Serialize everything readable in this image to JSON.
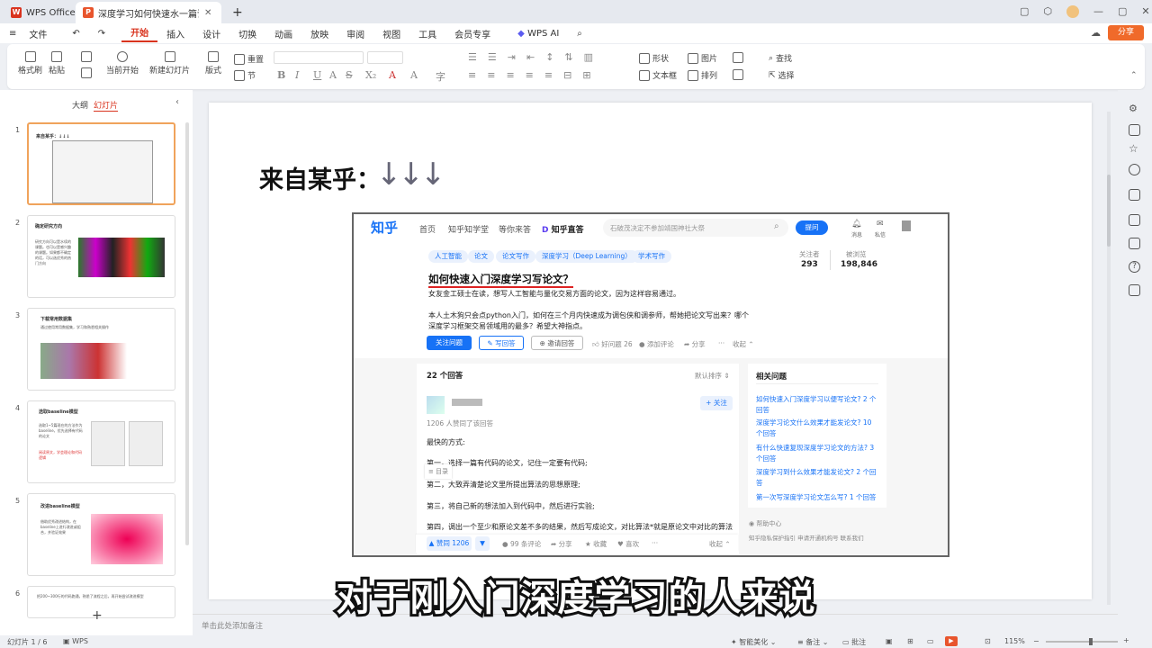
{
  "titlebar": {
    "app_tab": "WPS Office",
    "doc_tab": "深度学习如何快速水一篇论文...",
    "plus": "+"
  },
  "menubar": {
    "file": "文件",
    "items": [
      "开始",
      "插入",
      "设计",
      "切换",
      "动画",
      "放映",
      "审阅",
      "视图",
      "工具",
      "会员专享"
    ],
    "ai": "WPS AI",
    "share": "分享"
  },
  "ribbon": {
    "format_painter": "格式刷",
    "paste": "粘贴",
    "play_from": "当前开始",
    "new_slide": "新建幻灯片",
    "layout": "版式",
    "reset": "重置",
    "section": "节",
    "shape": "形状",
    "picture": "图片",
    "find": "查找",
    "textbox": "文本框",
    "arrange": "排列",
    "select": "选择"
  },
  "leftpanel": {
    "tab_outline": "大纲",
    "tab_slides": "幻灯片",
    "slides": [
      {
        "num": "1",
        "title": "来自某乎：↓↓↓"
      },
      {
        "num": "2",
        "title": "确定研究方向",
        "body": "研究方向可以是水续的课题。也可以是感兴趣的课题。如果都不确定的话，可以选优秀的热门方向"
      },
      {
        "num": "3",
        "title": "下载常用数据集",
        "body": "通过使用常用数据集，学习和熟悉相关操作"
      },
      {
        "num": "4",
        "title": "选取baseline模型",
        "body": "选取1~5篇现在的方法作为baseline，优先选择有代码的论文",
        "red": "阅读原文，学会理论和代码逻辑"
      },
      {
        "num": "5",
        "title": "改进baseline模型",
        "body": "借助优秀改进结构，在baseline上进行改进或组合，并验证效果"
      },
      {
        "num": "6",
        "body": "把200~300行的代码跑通，熟悉了流程之后，再开始尝试改进模型"
      }
    ]
  },
  "slide": {
    "title": "来自某乎：",
    "arrows": "↓↓↓",
    "subtitle": "对于刚入门深度学习的人来说"
  },
  "zhihu": {
    "logo": "知乎",
    "nav": [
      "首页",
      "知乎知学堂",
      "等你来答"
    ],
    "direct": "知乎直答",
    "search_placeholder": "石破茂决定不参加靖国神社大祭",
    "ask": "提问",
    "msg": "消息",
    "dm": "私信",
    "tags": [
      "人工智能",
      "论文",
      "论文写作",
      "深度学习（Deep Learning）",
      "学术写作"
    ],
    "followers_label": "关注者",
    "followers": "293",
    "views_label": "被浏览",
    "views": "198,846",
    "question": "如何快速入门深度学习写论文？",
    "desc1": "女友金工硕士在读，想写人工智能与量化交易方面的论文，因为这样容易通过。",
    "desc2": "本人土木狗只会点python入门，如何在三个月内快速成为调包侠和调参师，帮她把论文写出来？哪个",
    "desc3": "深度学习框架交易领域用的最多？希望大神指点。",
    "follow_q": "关注问题",
    "write": "写回答",
    "invite": "邀请回答",
    "good_q": "好问题 26",
    "comment": "添加评论",
    "share": "分享",
    "fold": "收起",
    "answers_count": "22 个回答",
    "sort": "默认排序",
    "follow_user": "关注",
    "agree_line": "1206 人赞同了该回答",
    "ans": [
      "最快的方式:",
      "第一，选择一篇有代码的论文，记住一定要有代码;",
      "第二，大致弄清楚论文里所提出算法的思想原理;",
      "第三，将自己新的想法加入到代码中，然后进行实验;",
      "第四，调出一个至少和原论文差不多的结果，然后写成论文，对比算法*就是原论文中对比的算法"
    ],
    "toc": "目录",
    "upvote": "赞同 1206",
    "comments": "99 条评论",
    "collect": "收藏",
    "like": "喜欢",
    "collapse": "收起",
    "related_title": "相关问题",
    "related": [
      "如何快速入门深度学习以便写论文? 2 个回答",
      "深度学习论文什么效果才能发论文? 10 个回答",
      "有什么快速复现深度学习论文的方法? 3 个回答",
      "深度学习到什么效果才能发论文? 2 个回答",
      "第一次写深度学习论文怎么写? 1 个回答"
    ],
    "help": "帮助中心",
    "footer": "知乎隐私保护指引  申请开通机构号  联系我们"
  },
  "notes": "单击此处添加备注",
  "status": {
    "slide_pos": "幻灯片 1 / 6",
    "wps": "WPS",
    "beautify": "智能美化",
    "notes_btn": "备注",
    "comment_btn": "批注",
    "zoom": "115%"
  }
}
